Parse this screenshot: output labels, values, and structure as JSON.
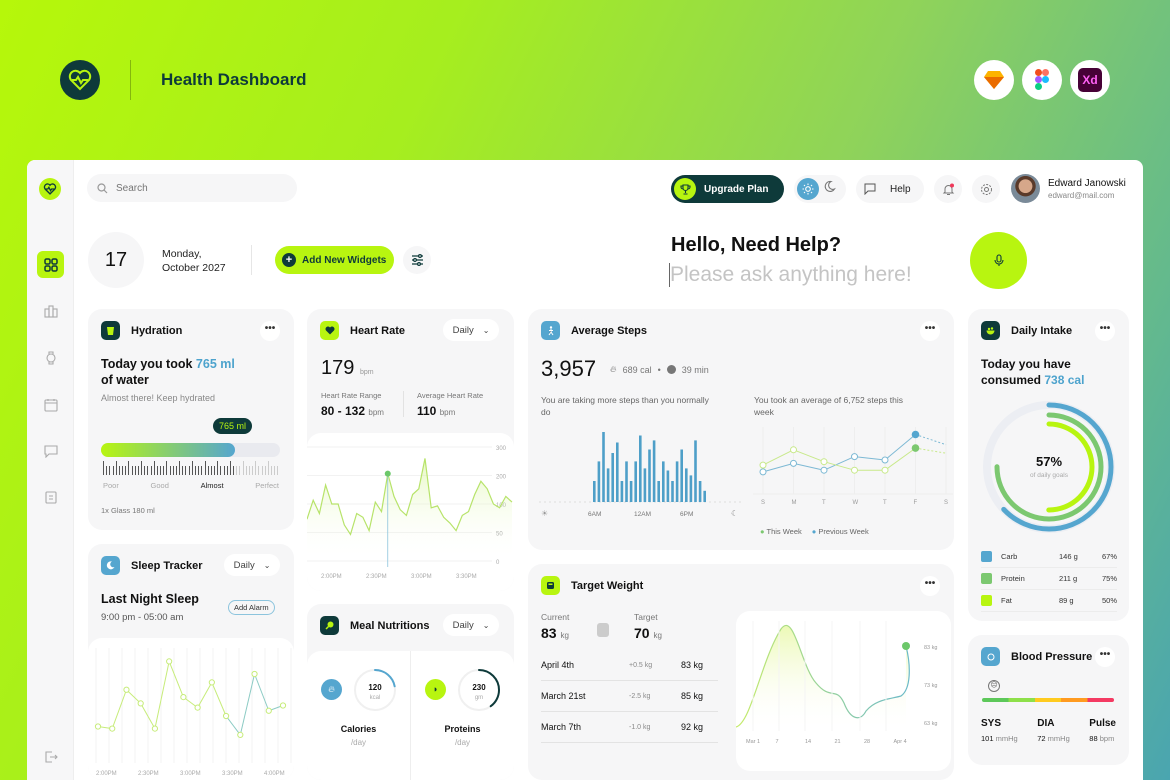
{
  "hero": {
    "title": "Health Dashboard",
    "tools": [
      "sketch-icon",
      "figma-icon",
      "xd-icon"
    ],
    "xd_label": "Xd"
  },
  "colors": {
    "accent": "#b8f510",
    "dark": "#0e3a3a",
    "blue": "#55a6cf",
    "green": "#7cc870"
  },
  "sidebar": {
    "items": [
      {
        "name": "dashboard",
        "icon": "grid-icon",
        "active": true
      },
      {
        "name": "statistics",
        "icon": "bar-chart-icon"
      },
      {
        "name": "devices",
        "icon": "watch-icon"
      },
      {
        "name": "calendar",
        "icon": "calendar-icon"
      },
      {
        "name": "messages",
        "icon": "chat-icon"
      },
      {
        "name": "reports",
        "icon": "clipboard-icon"
      }
    ],
    "logout": "logout-icon"
  },
  "topbar": {
    "search_placeholder": "Search",
    "upgrade_label": "Upgrade Plan",
    "help_label": "Help",
    "user": {
      "name": "Edward Janowski",
      "email": "edward@mail.com"
    }
  },
  "date": {
    "day": "17",
    "line1": "Monday,",
    "line2": "October 2027"
  },
  "add_widgets_label": "Add New Widgets",
  "assistant": {
    "title": "Hello, Need Help?",
    "placeholder": "Please ask anything here!"
  },
  "hydration": {
    "title": "Hydration",
    "text_prefix": "Today you took ",
    "amount": "765 ml",
    "text_suffix": "of water",
    "sub": "Almost there! Keep hydrated",
    "tooltip": "765 ml",
    "progress": 0.75,
    "scale": [
      "Poor",
      "Good",
      "Almost",
      "Perfect"
    ],
    "active_scale": "Almost",
    "glass": "1x Glass 180 ml"
  },
  "heart": {
    "title": "Heart Rate",
    "period": "Daily",
    "bpm": "179",
    "bpm_unit": "bpm",
    "range_label": "Heart Rate Range",
    "range": "80 - 132",
    "avg_label": "Average Heart Rate",
    "avg": "110",
    "unit": "bpm",
    "chart": {
      "yticks": [
        "300",
        "200",
        "100",
        "50",
        "0"
      ],
      "xticks": [
        "2:00PM",
        "2:30PM",
        "3:00PM",
        "3:30PM"
      ],
      "values": [
        110,
        160,
        125,
        200,
        150,
        150,
        95,
        70,
        125,
        115,
        80,
        155,
        130,
        230,
        170,
        135,
        120,
        175,
        190,
        270,
        140,
        145,
        115,
        100,
        80,
        120,
        130,
        175,
        210,
        190,
        150,
        140,
        170,
        155
      ],
      "highlight_index": 13
    }
  },
  "sleep": {
    "title": "Sleep Tracker",
    "period": "Daily",
    "heading": "Last Night Sleep",
    "time": "9:00 pm - 05:00 am",
    "alarm_label": "Add Alarm",
    "chart": {
      "xticks": [
        "2:00PM",
        "2:30PM",
        "3:00PM",
        "3:30PM",
        "4:00PM"
      ],
      "values": [
        30,
        28,
        65,
        52,
        28,
        92,
        58,
        48,
        72,
        40,
        22,
        80,
        45,
        50
      ]
    }
  },
  "meal": {
    "title": "Meal Nutritions",
    "period": "Daily",
    "items": [
      {
        "label": "Calories",
        "value": "120",
        "unit": "kcal",
        "per": "/day",
        "progress": 0.22,
        "icon": "flame-icon"
      },
      {
        "label": "Proteins",
        "value": "230",
        "unit": "gm",
        "per": "/day",
        "progress": 0.4,
        "icon": "meat-icon"
      }
    ]
  },
  "steps": {
    "title": "Average Steps",
    "total": "3,957",
    "cal": "689 cal",
    "time": "39 min",
    "left_text": "You are taking more steps than you normally do",
    "right_text": "You took an average of 6,752 steps this week",
    "bars": [
      30,
      58,
      100,
      48,
      70,
      85,
      30,
      58,
      30,
      58,
      95,
      48,
      75,
      88,
      30,
      58,
      45,
      30,
      58,
      75,
      48,
      38,
      88,
      30,
      16
    ],
    "bar_ticks": [
      "6AM",
      "12AM",
      "6PM"
    ],
    "week": {
      "days": [
        "S",
        "M",
        "T",
        "W",
        "T",
        "F",
        "S"
      ],
      "this_week": [
        34,
        52,
        38,
        28,
        28,
        54,
        48
      ],
      "previous_week": [
        26,
        36,
        28,
        44,
        40,
        70,
        58
      ],
      "legend": [
        "This Week",
        "Previous Week"
      ]
    }
  },
  "weight": {
    "title": "Target Weight",
    "current_label": "Current",
    "current": "83",
    "target_label": "Target",
    "target": "70",
    "unit": "kg",
    "history": [
      {
        "date": "April 4th",
        "change": "+0.5 kg",
        "weight": "83 kg"
      },
      {
        "date": "March 21st",
        "change": "-2.5 kg",
        "weight": "85 kg"
      },
      {
        "date": "March 7th",
        "change": "-1.0 kg",
        "weight": "92 kg"
      }
    ],
    "chart": {
      "yticks": [
        "83 kg",
        "73 kg",
        "63 kg"
      ],
      "xticks": [
        "Mar 1",
        "7",
        "14",
        "21",
        "28",
        "Apr 4"
      ]
    }
  },
  "intake": {
    "title": "Daily Intake",
    "text_prefix": "Today you have consumed ",
    "amount": "738 cal",
    "percent": "57%",
    "percent_label": "of daily goals",
    "rows": [
      {
        "name": "Carb",
        "grams": "146 g",
        "pct": "67%",
        "color": "#55a6cf",
        "value": 0.67
      },
      {
        "name": "Protein",
        "grams": "211 g",
        "pct": "75%",
        "color": "#7cc870",
        "value": 0.75
      },
      {
        "name": "Fat",
        "grams": "89 g",
        "pct": "50%",
        "color": "#b8f510",
        "value": 0.5
      }
    ]
  },
  "bp": {
    "title": "Blood Pressure",
    "stats": [
      {
        "label": "SYS",
        "value": "101",
        "unit": "mmHg"
      },
      {
        "label": "DIA",
        "value": "72",
        "unit": "mmHg"
      },
      {
        "label": "Pulse",
        "value": "88",
        "unit": "bpm"
      }
    ]
  }
}
